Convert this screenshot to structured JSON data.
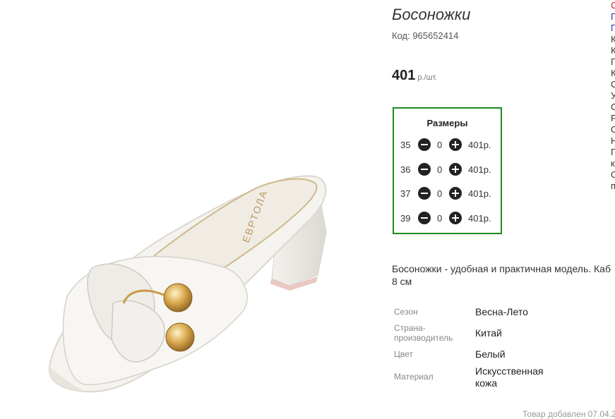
{
  "product": {
    "title": "Босоножки",
    "code": "Код: 965652414",
    "price": "401",
    "price_unit": "р./шт."
  },
  "sizes": {
    "title": "Размеры",
    "rows": [
      {
        "size": "35",
        "qty": "0",
        "price": "401р."
      },
      {
        "size": "36",
        "qty": "0",
        "price": "401р."
      },
      {
        "size": "37",
        "qty": "0",
        "price": "401р."
      },
      {
        "size": "39",
        "qty": "0",
        "price": "401р."
      }
    ]
  },
  "description": {
    "line1": "Босоножки - удобная и практичная модель. Каб",
    "line2": "8 см"
  },
  "attributes": [
    {
      "label": "Сезон",
      "value": "Весна-Лето"
    },
    {
      "label": "Страна-",
      "label2": "производитель",
      "value": "Китай"
    },
    {
      "label": "Цвет",
      "value": "Белый"
    },
    {
      "label": "Материал",
      "value": "Искусственная",
      "value2": "кожа"
    }
  ],
  "added": "Товар добавлен 07.04.2",
  "image": {
    "insole_brand": "ЕВРТОЛА"
  },
  "sidebar_cut": {
    "letters": [
      "С",
      "П",
      "П",
      "К",
      "К",
      "П",
      "К",
      "С",
      "У",
      "С",
      "Р",
      "С",
      "Н",
      "П",
      "к",
      "С",
      "п"
    ]
  },
  "colors": {
    "sizes_border": "#1e8a1e",
    "accent_red": "#cc2222",
    "link_blue": "#2233aa"
  }
}
